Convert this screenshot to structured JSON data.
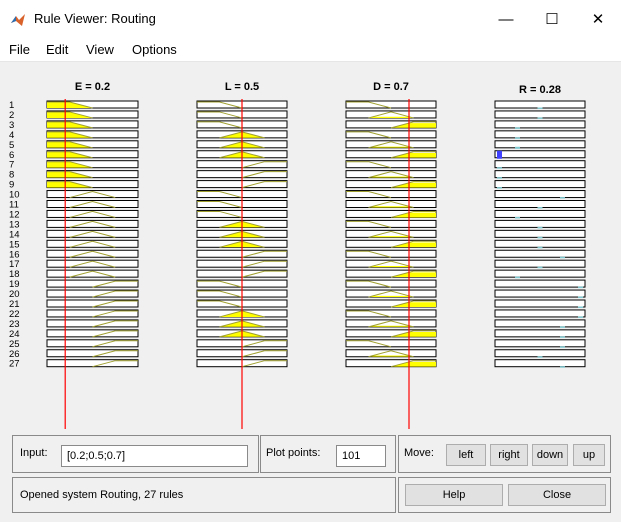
{
  "window": {
    "title": "Rule Viewer: Routing",
    "minimize_glyph": "—",
    "maximize_glyph": "☐",
    "close_glyph": "✕"
  },
  "menu": [
    "File",
    "Edit",
    "View",
    "Options"
  ],
  "columns": [
    {
      "label": "E = 0.2",
      "value": 0.2,
      "kind": "input"
    },
    {
      "label": "L = 0.5",
      "value": 0.5,
      "kind": "input"
    },
    {
      "label": "D = 0.7",
      "value": 0.7,
      "kind": "input"
    },
    {
      "label": "R = 0.28",
      "value": 0.28,
      "kind": "output"
    }
  ],
  "rules": {
    "count": 27,
    "numbers": [
      "1",
      "2",
      "3",
      "4",
      "5",
      "6",
      "7",
      "8",
      "9",
      "10",
      "11",
      "12",
      "13",
      "14",
      "15",
      "16",
      "17",
      "18",
      "19",
      "20",
      "21",
      "22",
      "23",
      "24",
      "25",
      "26",
      "27"
    ],
    "E": [
      "low",
      "low",
      "low",
      "low",
      "low",
      "low",
      "low",
      "low",
      "low",
      "mid",
      "mid",
      "mid",
      "mid",
      "mid",
      "mid",
      "mid",
      "mid",
      "mid",
      "high",
      "high",
      "high",
      "high",
      "high",
      "high",
      "high",
      "high",
      "high"
    ],
    "L": [
      "low",
      "low",
      "low",
      "mid",
      "mid",
      "mid",
      "high",
      "high",
      "high",
      "low",
      "low",
      "low",
      "mid",
      "mid",
      "mid",
      "high",
      "high",
      "high",
      "low",
      "low",
      "low",
      "mid",
      "mid",
      "mid",
      "high",
      "high",
      "high"
    ],
    "D": [
      "low",
      "mid",
      "high",
      "low",
      "mid",
      "high",
      "low",
      "mid",
      "high",
      "low",
      "mid",
      "high",
      "low",
      "mid",
      "high",
      "low",
      "mid",
      "high",
      "low",
      "mid",
      "high",
      "low",
      "mid",
      "high",
      "low",
      "mid",
      "high"
    ],
    "R_out": [
      0.5,
      0.5,
      0.25,
      0.25,
      0.25,
      0.05,
      0.05,
      0.05,
      0.05,
      0.75,
      0.5,
      0.25,
      0.5,
      0.5,
      0.5,
      0.75,
      0.5,
      0.25,
      0.95,
      0.95,
      0.95,
      0.95,
      0.75,
      0.75,
      0.75,
      0.5,
      0.75
    ]
  },
  "colors": {
    "fill": "#ffff00",
    "edge": "#a0a030",
    "line": "#ff0000",
    "output": "#80c8cf",
    "output_strong": "#4040ff"
  },
  "bottom": {
    "input_label": "Input:",
    "input_value": "[0.2;0.5;0.7]",
    "plot_points_label": "Plot points:",
    "plot_points_value": "101",
    "move_label": "Move:",
    "left": "left",
    "right": "right",
    "down": "down",
    "up": "up",
    "status": "Opened system Routing, 27 rules",
    "help": "Help",
    "close": "Close"
  }
}
